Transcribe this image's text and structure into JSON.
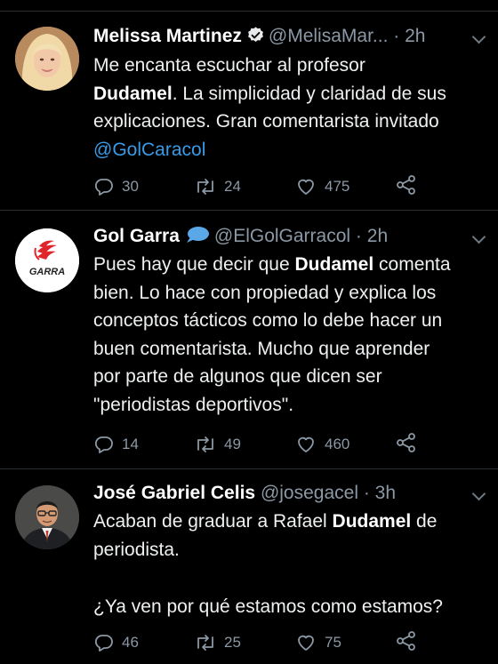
{
  "tweets": [
    {
      "name": "Melissa Martinez",
      "handle": "@MelisaMar...",
      "sep": "·",
      "time": "2h",
      "verified": true,
      "lines": [
        "Me encanta escuchar al profesor",
        {
          "bold": "Dudamel",
          "rest": ". La simplicidad y claridad de sus"
        },
        "explicaciones. Gran comentarista invitado",
        {
          "mention": "@GolCaracol"
        }
      ],
      "replies": "30",
      "retweets": "24",
      "likes": "475"
    },
    {
      "name": "Gol Garra",
      "handle": "@ElGolGarracol",
      "sep": "·",
      "time": "2h",
      "badge": "speech-bubble",
      "avatar_text": "GARRA",
      "lines": [
        {
          "pre": "Pues hay que decir que ",
          "bold": "Dudamel",
          "rest": " comenta"
        },
        "bien. Lo hace con propiedad y explica los",
        "conceptos tácticos como lo debe hacer un",
        "buen comentarista. Mucho que aprender",
        "por parte de algunos que dicen ser",
        "\"periodistas deportivos\"."
      ],
      "replies": "14",
      "retweets": "49",
      "likes": "460"
    },
    {
      "name": "José Gabriel Celis",
      "handle": "@josegacel",
      "sep": "·",
      "time": "3h",
      "lines": [
        {
          "pre": "Acaban de graduar a Rafael ",
          "bold": "Dudamel",
          "rest": " de"
        },
        "periodista.",
        "",
        "¿Ya ven por qué estamos como estamos?"
      ],
      "replies": "46",
      "retweets": "25",
      "likes": "75"
    }
  ],
  "colors": {
    "background": "#000000",
    "text": "#eef0f1",
    "muted": "#8b98a5",
    "link": "#3a9ae6",
    "divider": "#2a2f33"
  }
}
